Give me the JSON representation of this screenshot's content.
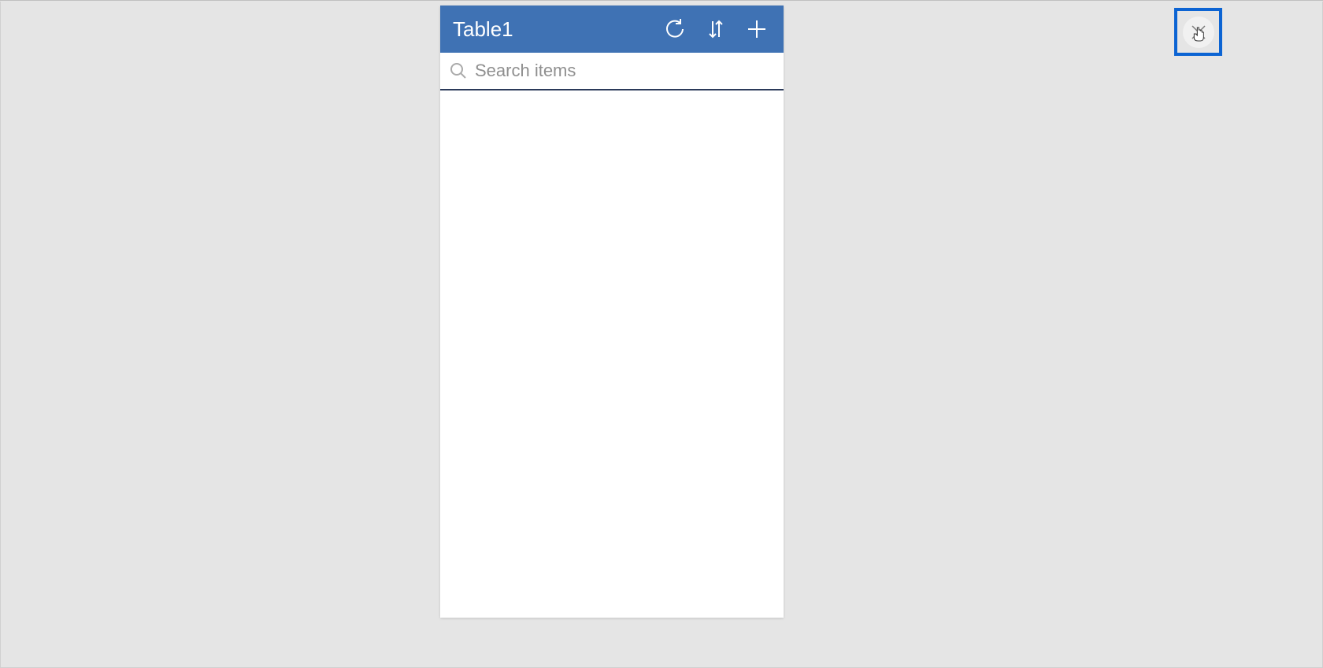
{
  "header": {
    "title": "Table1",
    "actions": {
      "refresh": "refresh",
      "sort": "sort",
      "add": "add"
    }
  },
  "search": {
    "placeholder": "Search items",
    "value": ""
  },
  "colors": {
    "header_bg": "#3F72B4",
    "highlight_border": "#0C64D3"
  }
}
